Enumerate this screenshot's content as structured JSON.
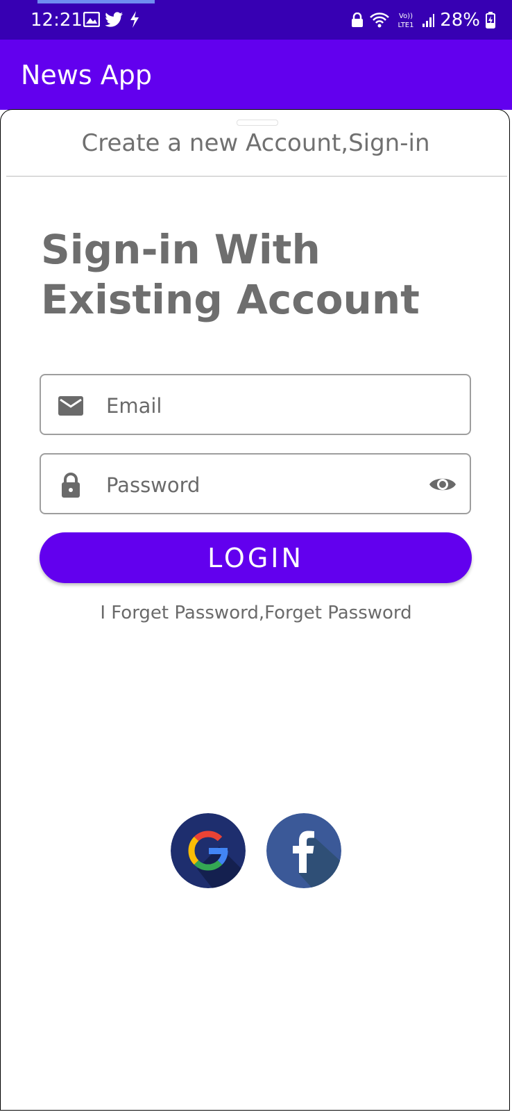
{
  "status_bar": {
    "time": "12:21",
    "battery_percent": "28%",
    "signal_label": "Vo)) LTE1",
    "icons": [
      "gallery-icon",
      "twitter-icon",
      "flash-icon",
      "lock-icon",
      "wifi-icon",
      "signal-icon",
      "battery-icon"
    ]
  },
  "app_bar": {
    "title": "News App"
  },
  "sheet": {
    "title": "Create a new Account,Sign-in",
    "heading_line1": "Sign-in With",
    "heading_line2": "Existing Account"
  },
  "form": {
    "email_placeholder": "Email",
    "email_value": "",
    "password_placeholder": "Password",
    "password_value": "",
    "login_label": "LOGIN",
    "forgot_label": "I Forget Password,Forget Password"
  },
  "social": {
    "google_icon": "google-icon",
    "facebook_icon": "facebook-icon"
  },
  "colors": {
    "status_bar": "#3700B3",
    "primary": "#6200EE",
    "text_gray": "#6e6e6e",
    "google_bg": "#1e2e6e",
    "facebook_bg": "#3b5998"
  }
}
